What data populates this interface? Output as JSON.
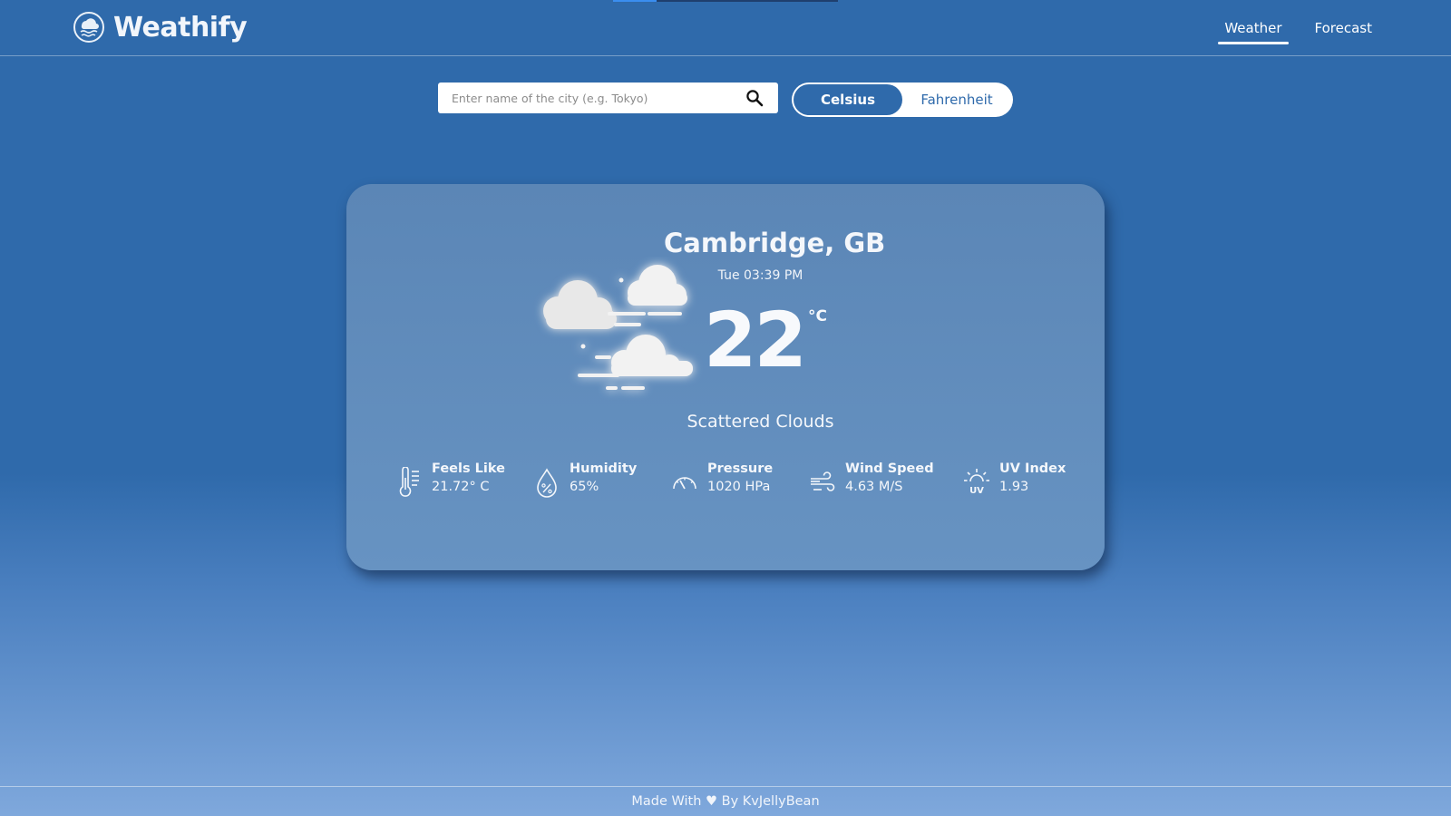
{
  "app": {
    "name": "Weathify"
  },
  "nav": {
    "items": [
      {
        "label": "Weather",
        "active": true
      },
      {
        "label": "Forecast",
        "active": false
      }
    ]
  },
  "search": {
    "placeholder": "Enter name of the city (e.g. Tokyo)",
    "value": ""
  },
  "units": {
    "options": [
      "Celsius",
      "Fahrenheit"
    ],
    "selected": "Celsius"
  },
  "current": {
    "location": "Cambridge, GB",
    "datetime": "Tue 03:39 PM",
    "temperature": "22",
    "unit": "°C",
    "condition": "Scattered Clouds",
    "icon": "scattered-clouds-icon"
  },
  "stats": [
    {
      "label": "Feels Like",
      "value": "21.72° C",
      "icon": "thermometer-icon"
    },
    {
      "label": "Humidity",
      "value": "65%",
      "icon": "humidity-drop-icon"
    },
    {
      "label": "Pressure",
      "value": "1020 HPa",
      "icon": "pressure-gauge-icon"
    },
    {
      "label": "Wind Speed",
      "value": "4.63 M/S",
      "icon": "wind-icon"
    },
    {
      "label": "UV Index",
      "value": "1.93",
      "icon": "uv-sun-icon"
    }
  ],
  "footer": {
    "text": "Made With ♥ By KvJellyBean"
  },
  "colors": {
    "background": "#2f6aab",
    "card": "#5f8bbb",
    "accent": "#ffffff"
  }
}
